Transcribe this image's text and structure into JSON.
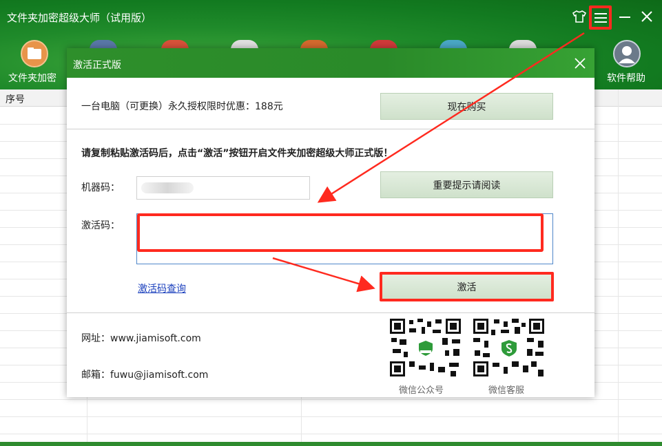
{
  "app": {
    "title": "文件夹加密超级大师（试用版）"
  },
  "toolbar": {
    "folder_label": "文件夹加密",
    "help_label": "软件帮助"
  },
  "table": {
    "col_seq": "序号"
  },
  "dialog": {
    "title": "激活正式版",
    "license_text": "一台电脑（可更换）永久授权限时优惠：188元",
    "buy_label": "现在购买",
    "instruction": "请复制粘贴激活码后，点击“激活”按钮开启文件夹加密超级大师正式版！",
    "machine_label": "机器码：",
    "notice_label": "重要提示请阅读",
    "code_label": "激活码：",
    "query_link": "激活码查询",
    "activate_label": "激活",
    "website": "网址：www.jiamisoft.com",
    "email": "邮箱：fuwu@jiamisoft.com",
    "qr_left_caption": "微信公众号",
    "qr_right_caption": "微信客服"
  },
  "colors": {
    "title_green": "#1f8a2a",
    "highlight_red": "#ff2a1f",
    "link_blue": "#1a3fbd"
  }
}
